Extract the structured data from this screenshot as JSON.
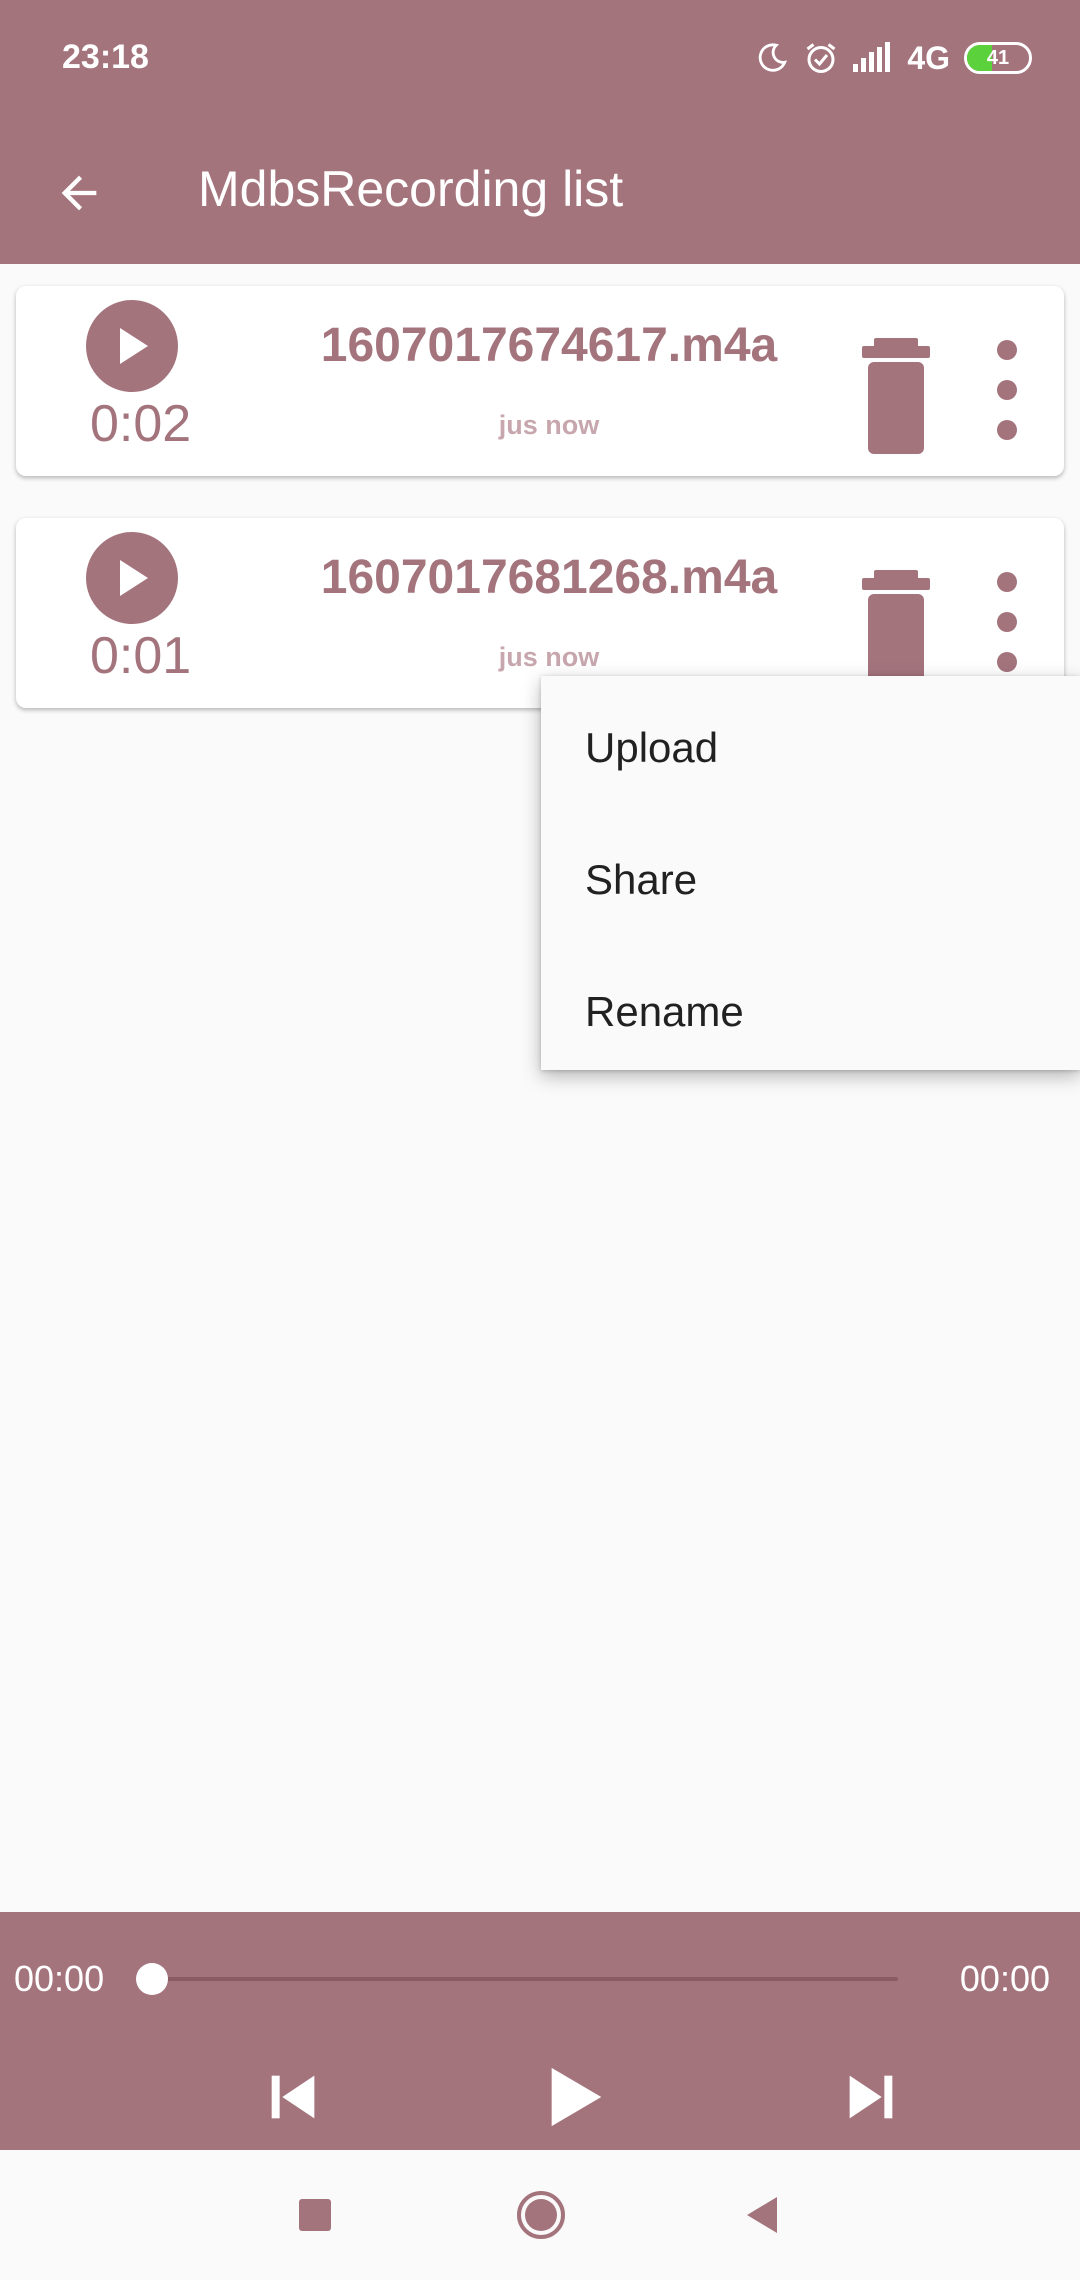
{
  "colors": {
    "accent": "#a4747d",
    "accent_light": "#c7a7ad",
    "background": "#fafafa",
    "battery_fill": "#5bd13b"
  },
  "status_bar": {
    "time": "23:18",
    "icons": [
      "moon-icon",
      "alarm-icon",
      "signal-icon"
    ],
    "network": "4G",
    "battery_level": "41"
  },
  "app_bar": {
    "back_icon": "arrow-back-icon",
    "title": "MdbsRecording list"
  },
  "recordings": [
    {
      "name": "1607017674617.m4a",
      "duration": "0:02",
      "time": "jus now"
    },
    {
      "name": "1607017681268.m4a",
      "duration": "0:01",
      "time": "jus now"
    }
  ],
  "popup_menu": {
    "items": [
      "Upload",
      "Share",
      "Rename"
    ]
  },
  "player": {
    "current_time": "00:00",
    "total_time": "00:00",
    "progress": 0,
    "controls": [
      "skip-previous-icon",
      "play-icon",
      "skip-next-icon"
    ]
  },
  "nav_bar": {
    "buttons": [
      "recent-apps-icon",
      "home-icon",
      "back-icon"
    ]
  }
}
